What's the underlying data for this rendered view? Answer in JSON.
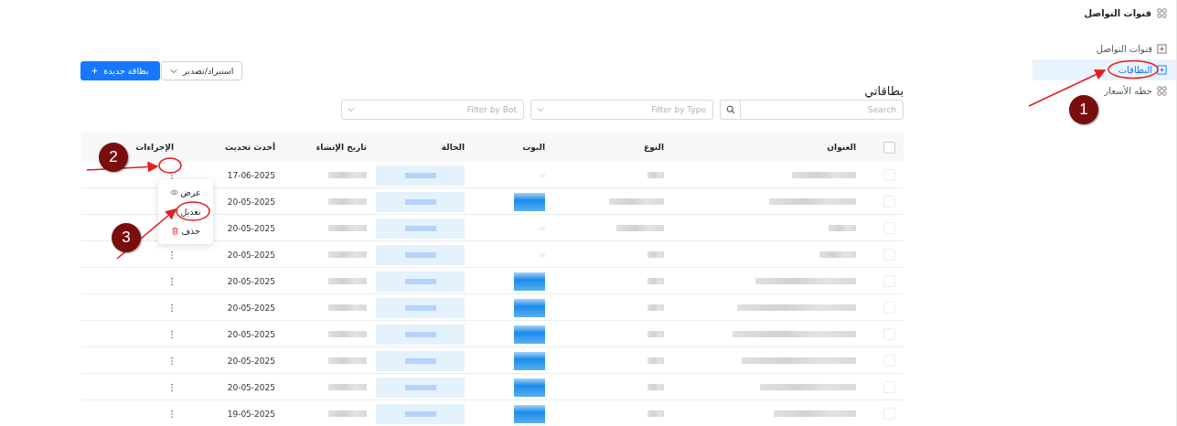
{
  "sidebar": {
    "title": "قنوات التواصل",
    "items": [
      {
        "label": "قنوات التواصل",
        "kind": "plus",
        "selected": false
      },
      {
        "label": "البطاقات",
        "kind": "plus",
        "selected": true
      },
      {
        "label": "خطه الأسعار",
        "kind": "grid",
        "selected": false
      }
    ]
  },
  "page": {
    "title": "بطاقاتي",
    "import_button": "استيراد/تصدير",
    "new_button": "بطاقة جديدة"
  },
  "filters": {
    "search": {
      "placeholder": "Search"
    },
    "type": {
      "placeholder": "Filter by Type"
    },
    "bot": {
      "placeholder": "Filter by Bot"
    }
  },
  "table": {
    "select_all": {
      "checked": false
    },
    "columns": [
      "العنوان",
      "النوع",
      "البوت",
      "الحالة",
      "تاريخ الإنشاء",
      "أحدث تحديث",
      "الإجراءات"
    ],
    "rows": [
      {
        "checked": false,
        "bot_badge": false,
        "updated": "17-06-2025"
      },
      {
        "checked": false,
        "bot_badge": true,
        "updated": "20-05-2025"
      },
      {
        "checked": false,
        "bot_badge": false,
        "updated": "20-05-2025"
      },
      {
        "checked": false,
        "bot_badge": false,
        "updated": "20-05-2025"
      },
      {
        "checked": false,
        "bot_badge": true,
        "updated": "20-05-2025"
      },
      {
        "checked": false,
        "bot_badge": true,
        "updated": "20-05-2025"
      },
      {
        "checked": false,
        "bot_badge": true,
        "updated": "20-05-2025"
      },
      {
        "checked": false,
        "bot_badge": true,
        "updated": "20-05-2025"
      },
      {
        "checked": false,
        "bot_badge": true,
        "updated": "20-05-2025"
      },
      {
        "checked": false,
        "bot_badge": true,
        "updated": "19-05-2025"
      }
    ]
  },
  "action_menu": {
    "items": [
      {
        "label": "عرض",
        "kind": "view"
      },
      {
        "label": "تعديل",
        "kind": "edit"
      },
      {
        "label": "حذف",
        "kind": "delete"
      }
    ]
  },
  "annotations": [
    {
      "number": "1"
    },
    {
      "number": "2"
    },
    {
      "number": "3"
    }
  ]
}
